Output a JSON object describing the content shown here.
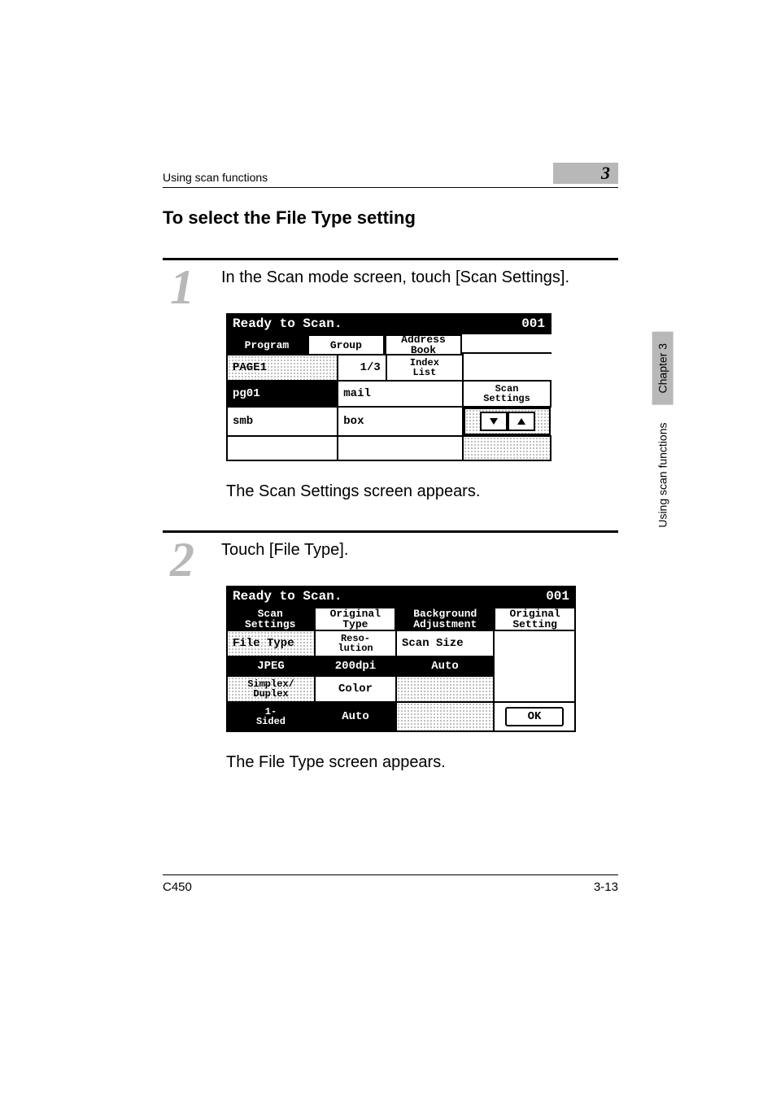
{
  "header": {
    "running": "Using scan functions",
    "chapter_number": "3"
  },
  "title": "To select the File Type setting",
  "step1": {
    "number": "1",
    "text": "In the Scan mode screen, touch [Scan Settings].",
    "after": "The Scan Settings screen appears."
  },
  "step2": {
    "number": "2",
    "text": "Touch [File Type].",
    "after": "The File Type screen appears."
  },
  "lcd1": {
    "status": "Ready to Scan.",
    "count": "001",
    "tabs": {
      "program": "Program",
      "group": "Group",
      "address_book": "Address\nBook"
    },
    "page": "PAGE1",
    "page_of": "1/3",
    "index_list": "Index\nList",
    "rows": {
      "r1c1": "pg01",
      "r1c2": "mail",
      "r2c1": "smb",
      "r2c2": "box"
    },
    "scan_settings": "Scan\nSettings",
    "arrow_down": "↓",
    "arrow_up": "↑"
  },
  "lcd2": {
    "status": "Ready to Scan.",
    "count": "001",
    "toptabs": {
      "scan_settings": "Scan\nSettings",
      "orig_type": "Original\nType",
      "bg_adjust": "Background\nAdjustment",
      "orig_setting": "Original\nSetting"
    },
    "labels": {
      "file_type": "File Type",
      "resolution": "Reso-\nlution",
      "scan_size": "Scan Size",
      "simplex_duplex": "Simplex/\nDuplex",
      "color": "Color"
    },
    "values": {
      "file_type": "JPEG",
      "resolution": "200dpi",
      "scan_size": "Auto",
      "simplex_duplex": "1-\nSided",
      "color": "Auto"
    },
    "ok": "OK"
  },
  "side": {
    "text": "Using scan functions",
    "chip": "Chapter 3"
  },
  "footer": {
    "left": "C450",
    "right": "3-13"
  }
}
